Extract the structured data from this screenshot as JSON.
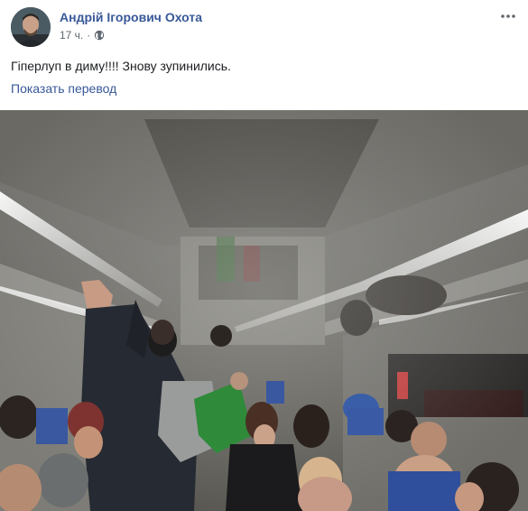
{
  "post": {
    "author": "Андрій Ігорович Охота",
    "timestamp": "17 ч.",
    "separator": "·",
    "audience_icon": "globe-icon",
    "text": "Гіперлуп в диму!!!! Знову зупинились.",
    "translate_label": "Показать перевод",
    "more_icon": "more-horizontal-icon"
  },
  "colors": {
    "link": "#385898",
    "text": "#1c1e21",
    "meta": "#606770"
  }
}
